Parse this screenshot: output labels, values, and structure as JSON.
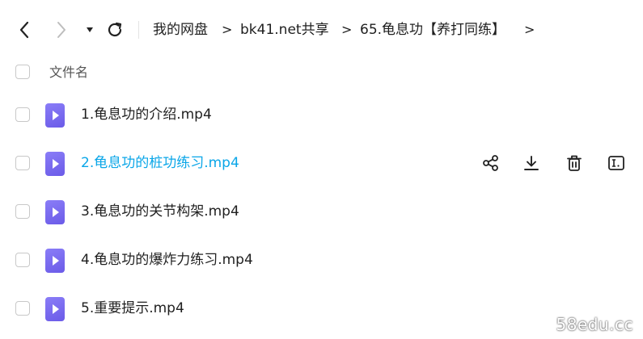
{
  "breadcrumb": {
    "items": [
      {
        "label": "我的网盘"
      },
      {
        "label": "bk41.net共享"
      },
      {
        "label": "65.龟息功【养打同练】"
      }
    ],
    "separator": ">"
  },
  "list": {
    "column_header": "文件名",
    "files": [
      {
        "name": "1.龟息功的介绍.mp4",
        "hover": false
      },
      {
        "name": "2.龟息功的桩功练习.mp4",
        "hover": true
      },
      {
        "name": "3.龟息功的关节构架.mp4",
        "hover": false
      },
      {
        "name": "4.龟息功的爆炸力练习.mp4",
        "hover": false
      },
      {
        "name": "5.重要提示.mp4",
        "hover": false
      }
    ]
  },
  "row_actions": [
    "share-icon",
    "download-icon",
    "delete-icon",
    "rename-icon"
  ],
  "watermark": "58edu.cc",
  "colors": {
    "hover_text": "#0aa6e8",
    "file_icon": "#7b6cf2",
    "text": "#1f1f1f"
  }
}
